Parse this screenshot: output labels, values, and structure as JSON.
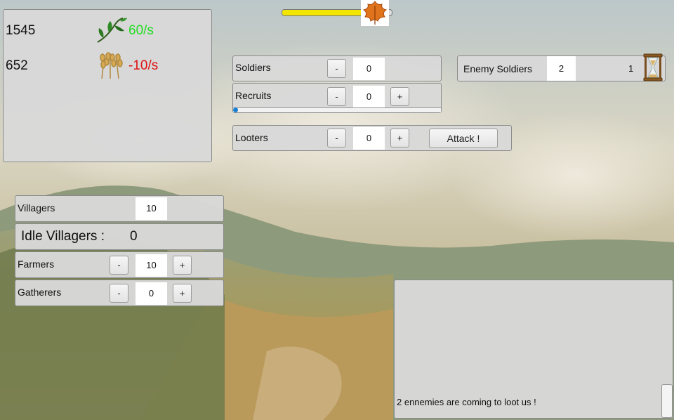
{
  "resources": {
    "food_amount": "1545",
    "food_rate": "60/s",
    "grain_amount": "652",
    "grain_rate": "-10/s"
  },
  "season": {
    "progress": 0.78,
    "icon": "autumn-leaf-icon"
  },
  "soldiers": {
    "label": "Soldiers",
    "value": "0",
    "minus": "-"
  },
  "recruits": {
    "label": "Recruits",
    "value": "0",
    "minus": "-",
    "plus": "+",
    "progress": 0.0
  },
  "looters": {
    "label": "Looters",
    "value": "0",
    "minus": "-",
    "plus": "+",
    "attack_label": "Attack !"
  },
  "enemy": {
    "label": "Enemy Soldiers",
    "count": "2",
    "timer": "1",
    "icon": "hourglass-icon"
  },
  "villagers": {
    "label": "Villagers",
    "value": "10"
  },
  "idle": {
    "label": "Idle Villagers :",
    "value": "0"
  },
  "farmers": {
    "label": "Farmers",
    "value": "10",
    "minus": "-",
    "plus": "+"
  },
  "gatherers": {
    "label": "Gatherers",
    "value": "0",
    "minus": "-",
    "plus": "+"
  },
  "log": {
    "messages": [
      "2 ennemies are coming to loot us !"
    ]
  },
  "colors": {
    "positive": "#22dd22",
    "negative": "#dd1111",
    "progress_fill": "#f2e600"
  }
}
